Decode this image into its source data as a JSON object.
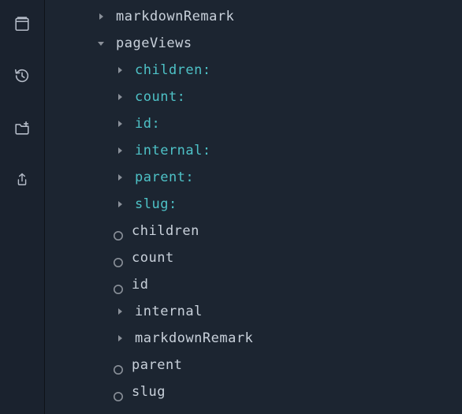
{
  "iconbar": {
    "items": [
      {
        "name": "docs-panel-icon"
      },
      {
        "name": "history-icon"
      },
      {
        "name": "new-folder-icon"
      },
      {
        "name": "share-icon"
      }
    ]
  },
  "tree": {
    "rows": [
      {
        "bullet": "collapsed",
        "label": "markdownRemark",
        "cls": "type-label",
        "indent": 1
      },
      {
        "bullet": "expanded",
        "label": "pageViews",
        "cls": "type-label",
        "indent": 1
      },
      {
        "bullet": "collapsed",
        "label": "children:",
        "cls": "field-link",
        "indent": 2
      },
      {
        "bullet": "collapsed",
        "label": "count:",
        "cls": "field-link",
        "indent": 2
      },
      {
        "bullet": "collapsed",
        "label": "id:",
        "cls": "field-link",
        "indent": 2
      },
      {
        "bullet": "collapsed",
        "label": "internal:",
        "cls": "field-link",
        "indent": 2
      },
      {
        "bullet": "collapsed",
        "label": "parent:",
        "cls": "field-link",
        "indent": 2
      },
      {
        "bullet": "collapsed",
        "label": "slug:",
        "cls": "field-link",
        "indent": 2
      },
      {
        "bullet": "circle",
        "label": "children",
        "cls": "type-label",
        "indent": 2
      },
      {
        "bullet": "circle",
        "label": "count",
        "cls": "type-label",
        "indent": 2
      },
      {
        "bullet": "circle",
        "label": "id",
        "cls": "type-label",
        "indent": 2
      },
      {
        "bullet": "collapsed",
        "label": "internal",
        "cls": "type-label",
        "indent": 2
      },
      {
        "bullet": "collapsed",
        "label": "markdownRemark",
        "cls": "type-label",
        "indent": 2
      },
      {
        "bullet": "circle",
        "label": "parent",
        "cls": "type-label",
        "indent": 2
      },
      {
        "bullet": "circle",
        "label": "slug",
        "cls": "type-label",
        "indent": 2
      }
    ]
  }
}
